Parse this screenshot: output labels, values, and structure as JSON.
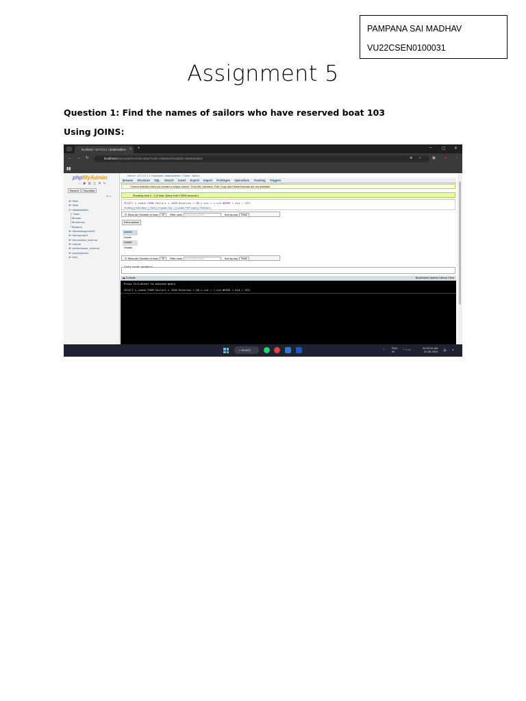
{
  "header_box": {
    "name": "PAMPANA SAI MADHAV",
    "roll": "VU22CSEN0100031"
  },
  "title": "Assignment 5",
  "question": "Question 1: Find the names of sailors who have reserved boat 103",
  "subheading": "Using JOINS:",
  "screenshot": {
    "browser": {
      "tab_title": "localhost / 127.0.0.1 / databstables",
      "url_host": "localhost",
      "url_path": "/phpmyadmin/index.php?route=/database/sql&db=databstables",
      "window_controls": [
        "–",
        "▢",
        "✕"
      ]
    },
    "pma": {
      "logo_a": "php",
      "logo_b": "MyAdmin",
      "side_tabs": [
        "Recent",
        "Favorites"
      ],
      "tree": [
        "New",
        "data",
        "databstables",
        "New",
        "boats",
        "reserves",
        "sailors",
        "dbmsassignment2",
        "dbmsproject",
        "information_schema",
        "mitmid",
        "performance_schema",
        "phpmyadmin",
        "test"
      ],
      "breadcrumb": "Server: 127.0.0.1 » Database: databstables » Table: Sailors",
      "menu": [
        "Browse",
        "Structure",
        "SQL",
        "Search",
        "Insert",
        "Export",
        "Import",
        "Privileges",
        "Operations",
        "Tracking",
        "Triggers"
      ],
      "warning": "Current selection does not contain a unique column. Grid edit, checkbox, Edit, Copy and Delete features are not available.",
      "success": "Showing rows 0 - 2 (3 total, Query took 0.0003 seconds.)",
      "sql_a": "SELECT",
      "sql_b": " s.sname ",
      "sql_c": "FROM",
      "sql_d": " Sailors s ",
      "sql_e": "JOIN",
      "sql_f": " Reserves r ",
      "sql_g": "ON",
      "sql_h": " s.sid = r.sid ",
      "sql_i": "WHERE",
      "sql_j": " r.bid = 103;",
      "sql_links": "Profiling [ Edit inline ] [ Edit ] [ Explain SQL ] [ Create PHP code ] [ Refresh ]",
      "controls": {
        "show_all": "Show all",
        "rows_label": "Number of rows:",
        "rows_value": "25",
        "filter_label": "Filter rows:",
        "filter_placeholder": "Search this table",
        "sort_label": "Sort by key:",
        "sort_value": "None"
      },
      "extra_options": "Extra options",
      "column": "sname",
      "rows": [
        "Dustin",
        "Lubber",
        "Horatio"
      ],
      "query_ops": "Query results operations",
      "console_label": "Console",
      "console_links": "Bookmarks  Options  History  Clear",
      "console_hint": "Press Ctrl+Enter to execute query",
      "console_sql": "SELECT s.sname FROM Sailors s JOIN Reserves r ON s.sid = r.sid WHERE r.bid = 103;"
    },
    "taskbar": {
      "search": "Search",
      "lang": "ENG",
      "region": "IN",
      "time": "09:39:31 AM",
      "date": "20-08-2024"
    }
  }
}
